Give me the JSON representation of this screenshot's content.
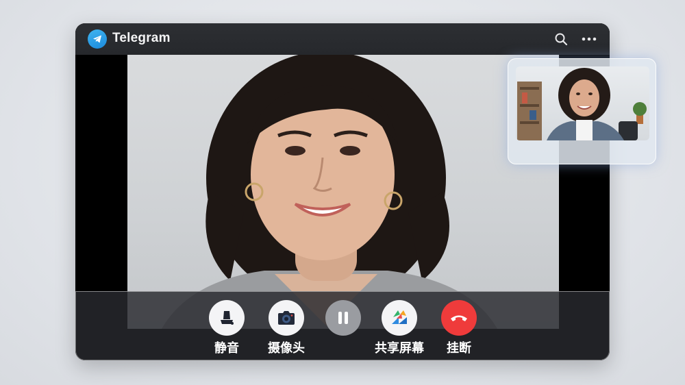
{
  "app": {
    "title": "Telegram",
    "accent": "#2aa3ef"
  },
  "titlebar": {
    "icons": [
      "search-icon",
      "more-icon"
    ]
  },
  "controls": [
    {
      "label": "静音",
      "icon": "mute-icon",
      "bg": "#f4f4f6"
    },
    {
      "label": "摄像头",
      "icon": "camera-icon",
      "bg": "#f4f4f6"
    },
    {
      "label": "",
      "icon": "pause-icon",
      "bg": "#9a9ca1"
    },
    {
      "label": "共享屏幕",
      "icon": "screen-share-icon",
      "bg": "#f4f4f6"
    },
    {
      "label": "挂断",
      "icon": "hang-up-icon",
      "bg": "#ef3b3b"
    }
  ],
  "colors": {
    "hangup": "#ef3b3b",
    "titlebar": "#2a2c30"
  }
}
